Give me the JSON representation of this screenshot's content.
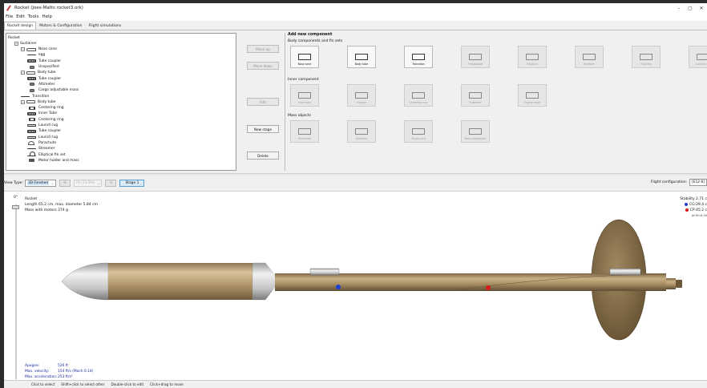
{
  "window": {
    "title": "Rocket (Joes-Matts rocket3.ork)",
    "controls": [
      "–",
      "▢",
      "✕"
    ]
  },
  "menu": [
    "File",
    "Edit",
    "Tools",
    "Help"
  ],
  "tabs": [
    {
      "label": "Rocket design",
      "active": true
    },
    {
      "label": "Motors & Configuration",
      "active": false
    },
    {
      "label": "Flight simulations",
      "active": false
    }
  ],
  "tree": [
    {
      "label": "Rocket",
      "depth": 0,
      "icon": "none",
      "toggle": ""
    },
    {
      "label": "Sustainer",
      "depth": 1,
      "icon": "none",
      "toggle": "−"
    },
    {
      "label": "Nose cone",
      "depth": 2,
      "icon": "nose",
      "toggle": "−"
    },
    {
      "label": "egg",
      "depth": 3,
      "icon": "line",
      "toggle": ""
    },
    {
      "label": "Tube coupler",
      "depth": 3,
      "icon": "coupler",
      "toggle": ""
    },
    {
      "label": "Unspecified",
      "depth": 3,
      "icon": "mass",
      "toggle": ""
    },
    {
      "label": "Body tube",
      "depth": 2,
      "icon": "tube",
      "toggle": "−"
    },
    {
      "label": "Tube coupler",
      "depth": 3,
      "icon": "coupler",
      "toggle": ""
    },
    {
      "label": "Altimeter",
      "depth": 3,
      "icon": "mass",
      "toggle": ""
    },
    {
      "label": "Cargo adjustable mass",
      "depth": 3,
      "icon": "mass",
      "toggle": ""
    },
    {
      "label": "Transition",
      "depth": 2,
      "icon": "line",
      "toggle": ""
    },
    {
      "label": "Body tube",
      "depth": 2,
      "icon": "tube",
      "toggle": "−"
    },
    {
      "label": "Centering ring",
      "depth": 3,
      "icon": "ring",
      "toggle": ""
    },
    {
      "label": "Inner Tube",
      "depth": 3,
      "icon": "coupler",
      "toggle": ""
    },
    {
      "label": "Centering ring",
      "depth": 3,
      "icon": "ring",
      "toggle": ""
    },
    {
      "label": "Launch lug",
      "depth": 3,
      "icon": "lug",
      "toggle": ""
    },
    {
      "label": "Tube coupler",
      "depth": 3,
      "icon": "coupler",
      "toggle": ""
    },
    {
      "label": "Launch lug",
      "depth": 3,
      "icon": "lug",
      "toggle": ""
    },
    {
      "label": "Parachute",
      "depth": 3,
      "icon": "chute",
      "toggle": ""
    },
    {
      "label": "Streamer",
      "depth": 3,
      "icon": "line",
      "toggle": ""
    },
    {
      "label": "Elliptical fin set",
      "depth": 3,
      "icon": "fin",
      "toggle": ""
    },
    {
      "label": "Motor holder and mass",
      "depth": 3,
      "icon": "holder",
      "toggle": ""
    }
  ],
  "side_buttons": {
    "move_up": "Move up",
    "move_down": "Move down",
    "edit": "Edit",
    "new_stage": "New stage",
    "delete": "Delete"
  },
  "add_component": {
    "title": "Add new component",
    "body_section": "Body components and fin sets",
    "inner_section": "Inner component",
    "mass_section": "Mass objects",
    "body_items": [
      {
        "label": "Nose cone",
        "icon": "nose-cone-icon",
        "enabled": true
      },
      {
        "label": "Body tube",
        "icon": "body-tube-icon",
        "enabled": true
      },
      {
        "label": "Transition",
        "icon": "transition-icon",
        "enabled": true
      },
      {
        "label": "Trapezoidal",
        "icon": "trapezoidal-fin-icon",
        "enabled": false
      },
      {
        "label": "Elliptical",
        "icon": "elliptical-fin-icon",
        "enabled": false
      },
      {
        "label": "Freeform",
        "icon": "freeform-fin-icon",
        "enabled": false
      },
      {
        "label": "Tube fins",
        "icon": "tube-fin-icon",
        "enabled": false
      },
      {
        "label": "Launch lug",
        "icon": "launch-lug-icon",
        "enabled": false
      }
    ],
    "inner_items": [
      {
        "label": "Inner tube",
        "icon": "inner-tube-icon",
        "enabled": false
      },
      {
        "label": "Coupler",
        "icon": "coupler-icon",
        "enabled": false
      },
      {
        "label": "Centering ring",
        "icon": "centering-ring-icon",
        "enabled": false
      },
      {
        "label": "Bulkhead",
        "icon": "bulkhead-icon",
        "enabled": false
      },
      {
        "label": "Engine block",
        "icon": "engine-block-icon",
        "enabled": false
      }
    ],
    "mass_items": [
      {
        "label": "Parachute",
        "icon": "parachute-icon",
        "enabled": false
      },
      {
        "label": "Streamer",
        "icon": "streamer-icon",
        "enabled": false
      },
      {
        "label": "Shock cord",
        "icon": "shock-cord-icon",
        "enabled": false
      },
      {
        "label": "Mass component",
        "icon": "mass-component-icon",
        "enabled": false
      }
    ]
  },
  "view_bar": {
    "view_type_label": "View Type:",
    "view_type_value": "3D Finished",
    "zoom_value": "Fit (71.9%)",
    "stage_label": "Stage 1",
    "flight_config_label": "Flight configuration:",
    "flight_config_value": "[E12-6]"
  },
  "figure": {
    "rotation_label": "0°",
    "rocket_name": "Rocket",
    "dimensions": "Length 65.2 cm, max. diameter 5.84 cm",
    "mass": "Mass with motors 374 g",
    "stability": "Stability 2.71 c",
    "cg": "CG:29.4 c",
    "cp": "CP:45.2 c",
    "mach": "at M=0.30",
    "cg_color": "#1a3fd8",
    "cp_color": "#d81a1a",
    "stats": [
      {
        "label": "Apogee:",
        "value": "526 ft"
      },
      {
        "label": "Max. velocity:",
        "value": "154 ft/s  (Mach 0.14)"
      },
      {
        "label": "Max. acceleration:",
        "value": "253 ft/s²"
      }
    ]
  },
  "status_hints": [
    "Click to select",
    "Shift+click to select other",
    "Double-click to edit",
    "Click+drag to move"
  ]
}
